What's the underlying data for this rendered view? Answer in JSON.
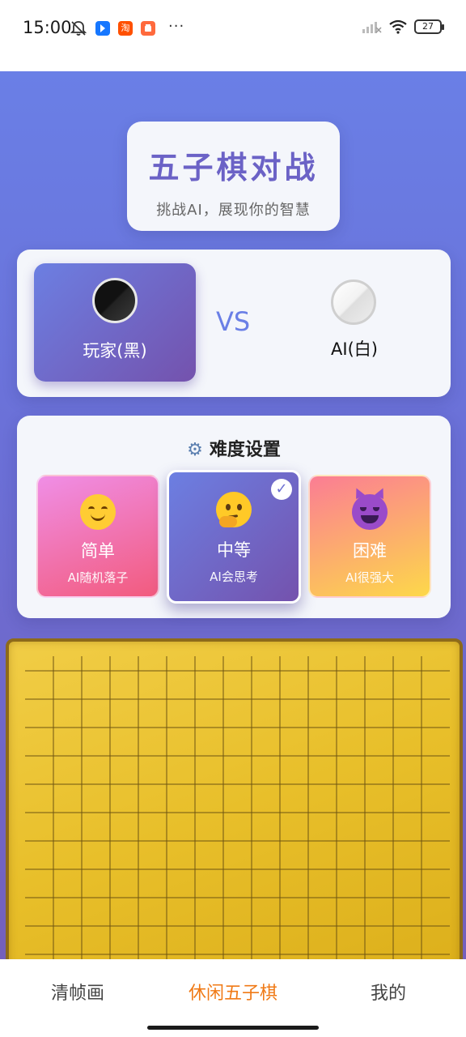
{
  "status_bar": {
    "time": "15:00",
    "dots": "···",
    "battery": "27",
    "taobao_glyph": "淘"
  },
  "header": {
    "title": "五子棋对战",
    "subtitle": "挑战AI，展现你的智慧"
  },
  "versus": {
    "player_label": "玩家(黑)",
    "vs_label": "VS",
    "ai_label": "AI(白)"
  },
  "difficulty": {
    "title": "难度设置",
    "options": [
      {
        "name": "简单",
        "desc": "AI随机落子",
        "selected": false
      },
      {
        "name": "中等",
        "desc": "AI会思考",
        "selected": true
      },
      {
        "name": "困难",
        "desc": "AI很强大",
        "selected": false
      }
    ]
  },
  "tabs": [
    {
      "label": "清帧画"
    },
    {
      "label": "休闲五子棋",
      "active": true
    },
    {
      "label": "我的"
    }
  ],
  "colors": {
    "accent": "#6b62c6",
    "active_tab": "#f07a16",
    "board": "#e8bf2a"
  },
  "icons": {
    "status_left": [
      "mute-bell-icon",
      "blue-app-icon",
      "taobao-icon",
      "orange-app-icon",
      "more-dots-icon"
    ],
    "status_right": [
      "signal-icon",
      "wifi-icon",
      "battery-icon"
    ],
    "difficulty_title": "gear-icon"
  }
}
